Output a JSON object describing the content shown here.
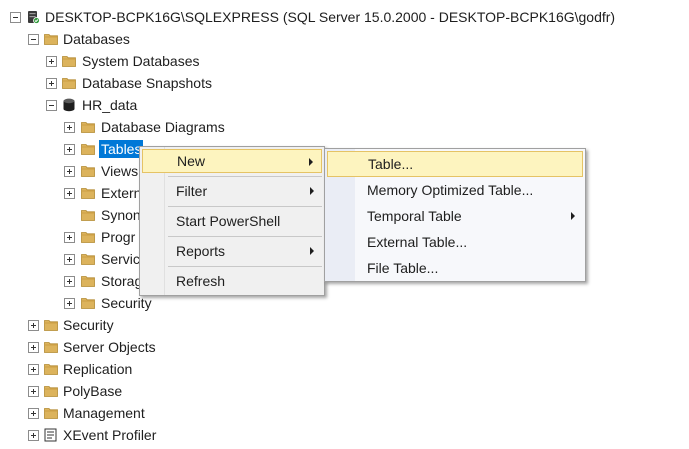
{
  "tree": {
    "server": "DESKTOP-BCPK16G\\SQLEXPRESS (SQL Server 15.0.2000 - DESKTOP-BCPK16G\\godfr)",
    "databases": "Databases",
    "system_databases": "System Databases",
    "database_snapshots": "Database Snapshots",
    "hr_data": "HR_data",
    "database_diagrams": "Database Diagrams",
    "tables": "Tables",
    "views": "Views",
    "external": "Extern",
    "synonyms": "Synon",
    "programmability": "Progr",
    "service": "Servic",
    "storage": "Storag",
    "db_security": "Security",
    "security": "Security",
    "server_objects": "Server Objects",
    "replication": "Replication",
    "polybase": "PolyBase",
    "management": "Management",
    "xevent_profiler": "XEvent Profiler"
  },
  "context_menu": {
    "new": "New",
    "filter": "Filter",
    "start_powershell": "Start PowerShell",
    "reports": "Reports",
    "refresh": "Refresh"
  },
  "submenu": {
    "table": "Table...",
    "memory_optimized_table": "Memory Optimized Table...",
    "temporal_table": "Temporal Table",
    "external_table": "External Table...",
    "file_table": "File Table..."
  },
  "colors": {
    "selection": "#0078d7",
    "menu_highlight": "#fdf4bf",
    "folder": "#dcb35c"
  }
}
